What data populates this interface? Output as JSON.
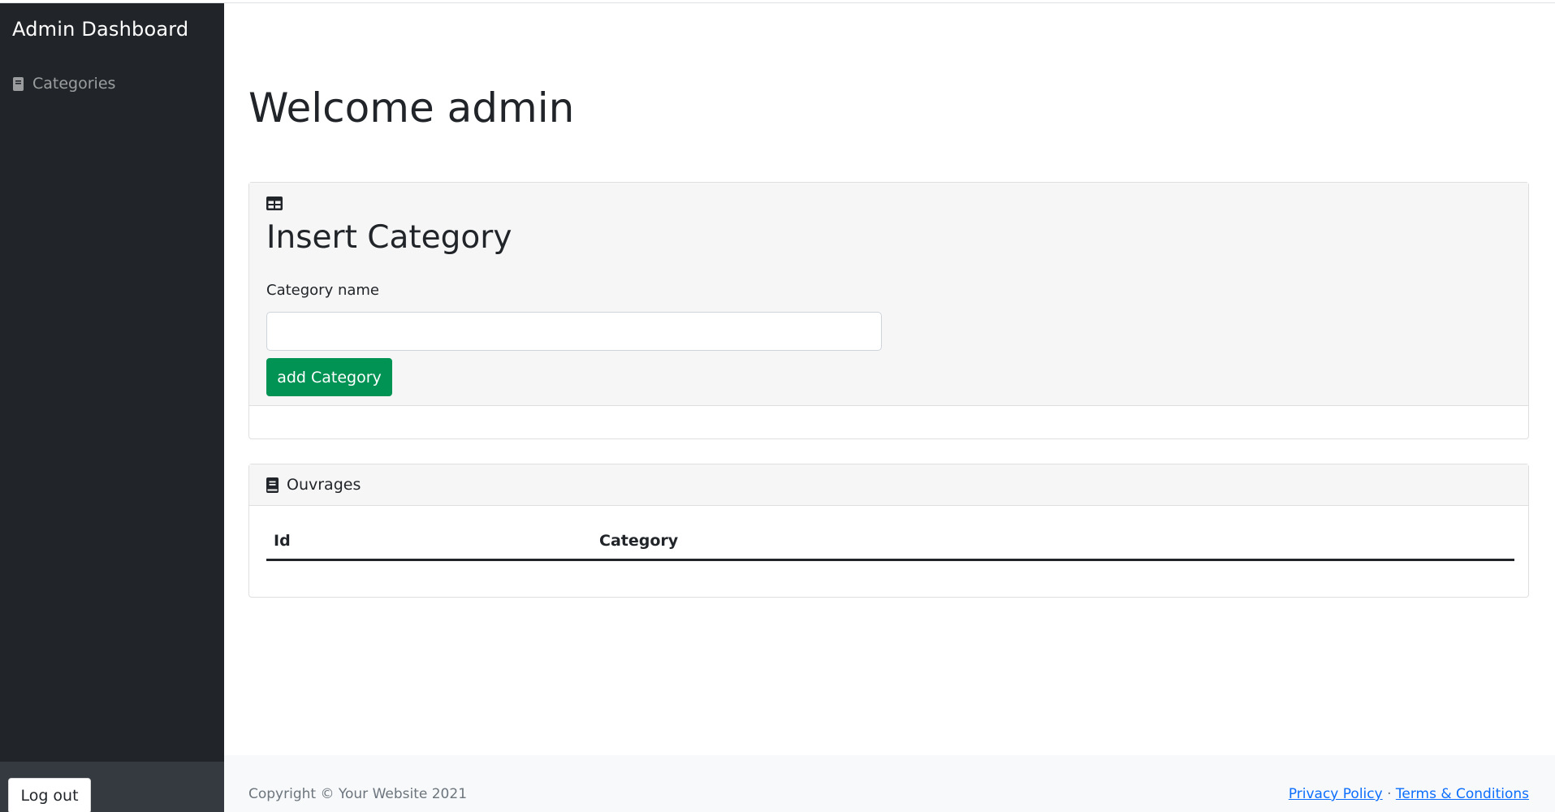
{
  "sidebar": {
    "brand": "Admin Dashboard",
    "items": [
      {
        "label": "Categories",
        "icon": "book-icon"
      }
    ],
    "logout_label": "Log out"
  },
  "main": {
    "title": "Welcome admin",
    "insert_card": {
      "icon": "table-icon",
      "heading": "Insert Category",
      "field_label": "Category name",
      "input_value": "",
      "button_label": "add Category"
    },
    "list_card": {
      "icon": "book-icon",
      "header": "Ouvrages",
      "columns": [
        "Id",
        "Category"
      ],
      "rows": []
    }
  },
  "footer": {
    "copyright": "Copyright © Your Website 2021",
    "links": [
      "Privacy Policy",
      "Terms & Conditions"
    ],
    "separator": "·"
  },
  "colors": {
    "sidebar_bg": "#212529",
    "primary_button": "#009354",
    "link": "#0d6efd",
    "footer_bg": "#f8f9fa"
  }
}
